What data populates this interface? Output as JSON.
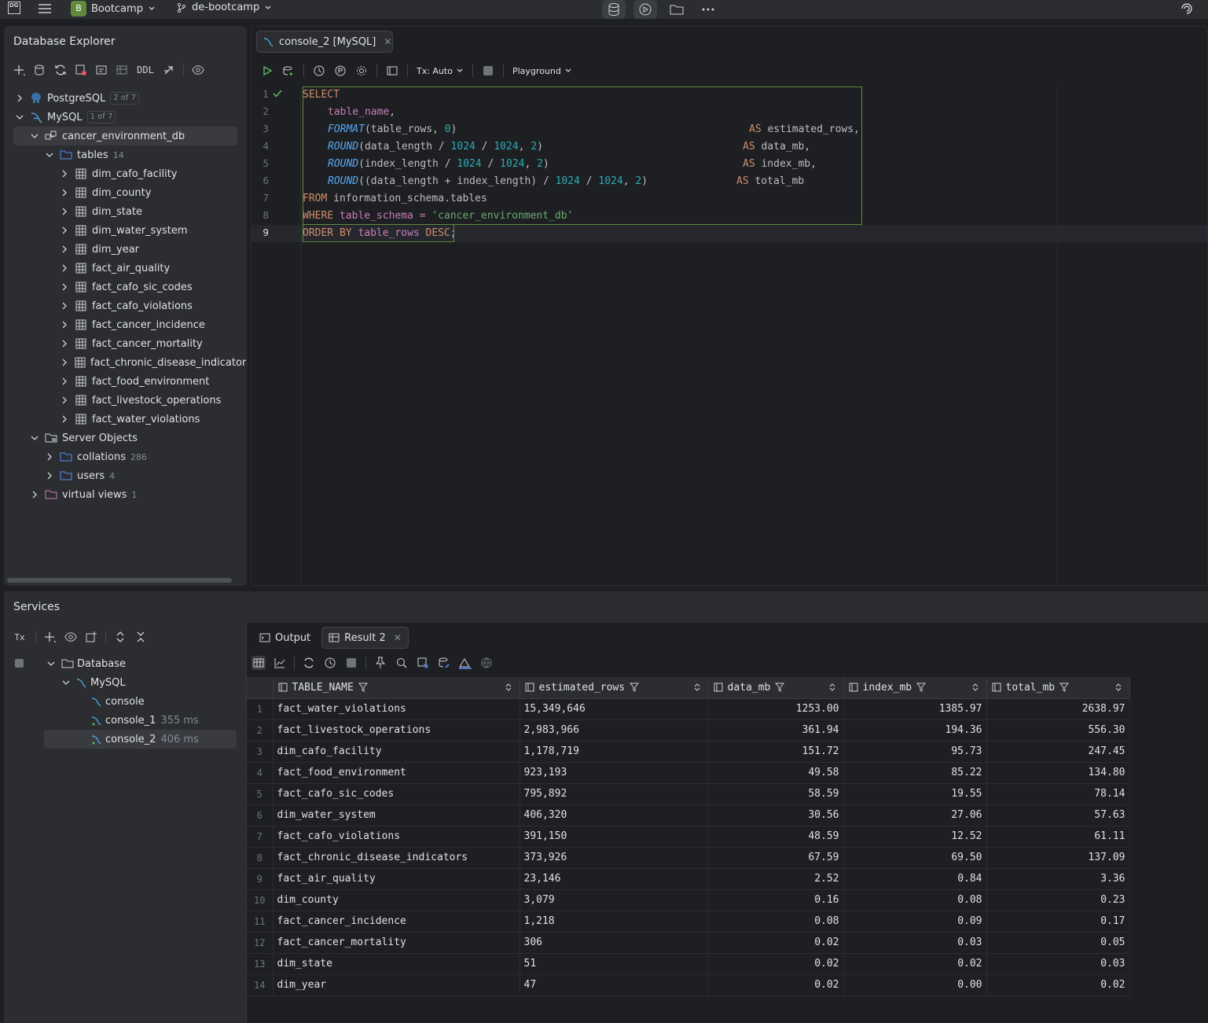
{
  "topbar": {
    "app_logo": "DG",
    "project_badge": "B",
    "project_name": "Bootcamp",
    "branch_name": "de-bootcamp"
  },
  "explorer": {
    "title": "Database Explorer",
    "toolbar_ddl": "DDL",
    "postgres": {
      "label": "PostgreSQL",
      "count": "2 of 7"
    },
    "mysql": {
      "label": "MySQL",
      "count": "1 of 7"
    },
    "schema": "cancer_environment_db",
    "tables_folder": {
      "label": "tables",
      "count": "14"
    },
    "tables": [
      "dim_cafo_facility",
      "dim_county",
      "dim_state",
      "dim_water_system",
      "dim_year",
      "fact_air_quality",
      "fact_cafo_sic_codes",
      "fact_cafo_violations",
      "fact_cancer_incidence",
      "fact_cancer_mortality",
      "fact_chronic_disease_indicators",
      "fact_food_environment",
      "fact_livestock_operations",
      "fact_water_violations"
    ],
    "server_objects": "Server Objects",
    "collations": {
      "label": "collations",
      "count": "286"
    },
    "users": {
      "label": "users",
      "count": "4"
    },
    "virtual_views": {
      "label": "virtual views",
      "count": "1"
    }
  },
  "editor": {
    "tab_label": "console_2 [MySQL]",
    "tx_mode": "Tx: Auto",
    "playground": "Playground",
    "line_numbers": [
      "1",
      "2",
      "3",
      "4",
      "5",
      "6",
      "7",
      "8",
      "9"
    ],
    "code": {
      "l1_kw": "SELECT",
      "l2_col": "table_name",
      "l2_punct": ",",
      "l3_fn": "FORMAT",
      "l3_a": "(table_rows, ",
      "l3_num": "0",
      "l3_b": ")",
      "l3_as": "AS",
      "l3_alias": " estimated_rows,",
      "l4_fn": "ROUND",
      "l4_a": "(data_length / ",
      "l4_n1": "1024",
      "l4_b": " / ",
      "l4_n2": "1024",
      "l4_c": ", ",
      "l4_n3": "2",
      "l4_d": ")",
      "l4_as": "AS",
      "l4_alias": " data_mb,",
      "l5_fn": "ROUND",
      "l5_a": "(index_length / ",
      "l5_n1": "1024",
      "l5_b": " / ",
      "l5_n2": "1024",
      "l5_c": ", ",
      "l5_n3": "2",
      "l5_d": ")",
      "l5_as": "AS",
      "l5_alias": " index_mb,",
      "l6_fn": "ROUND",
      "l6_a": "((data_length + index_length) / ",
      "l6_n1": "1024",
      "l6_b": " / ",
      "l6_n2": "1024",
      "l6_c": ", ",
      "l6_n3": "2",
      "l6_d": ")",
      "l6_as": "AS",
      "l6_alias": " total_mb",
      "l7_kw": "FROM",
      "l7_rest": " information_schema.tables",
      "l8_kw": "WHERE",
      "l8_a": " table_schema = ",
      "l8_str": "'cancer_environment_db'",
      "l9_kw": "ORDER BY",
      "l9_a": " table_rows ",
      "l9_kw2": "DESC",
      "l9_end": ";"
    }
  },
  "services": {
    "title": "Services",
    "tx_label": "Tx",
    "tree": {
      "database": "Database",
      "mysql": "MySQL",
      "consoles": [
        {
          "label": "console",
          "duration": ""
        },
        {
          "label": "console_1",
          "duration": "355 ms"
        },
        {
          "label": "console_2",
          "duration": "406 ms"
        }
      ]
    },
    "tabs": {
      "output": "Output",
      "result": "Result 2"
    },
    "columns": [
      "TABLE_NAME",
      "estimated_rows",
      "data_mb",
      "index_mb",
      "total_mb"
    ],
    "rows": [
      [
        "1",
        "fact_water_violations",
        "15,349,646",
        "1253.00",
        "1385.97",
        "2638.97"
      ],
      [
        "2",
        "fact_livestock_operations",
        "2,983,966",
        "361.94",
        "194.36",
        "556.30"
      ],
      [
        "3",
        "dim_cafo_facility",
        "1,178,719",
        "151.72",
        "95.73",
        "247.45"
      ],
      [
        "4",
        "fact_food_environment",
        "923,193",
        "49.58",
        "85.22",
        "134.80"
      ],
      [
        "5",
        "fact_cafo_sic_codes",
        "795,892",
        "58.59",
        "19.55",
        "78.14"
      ],
      [
        "6",
        "dim_water_system",
        "406,320",
        "30.56",
        "27.06",
        "57.63"
      ],
      [
        "7",
        "fact_cafo_violations",
        "391,150",
        "48.59",
        "12.52",
        "61.11"
      ],
      [
        "8",
        "fact_chronic_disease_indicators",
        "373,926",
        "67.59",
        "69.50",
        "137.09"
      ],
      [
        "9",
        "fact_air_quality",
        "23,146",
        "2.52",
        "0.84",
        "3.36"
      ],
      [
        "10",
        "dim_county",
        "3,079",
        "0.16",
        "0.08",
        "0.23"
      ],
      [
        "11",
        "fact_cancer_incidence",
        "1,218",
        "0.08",
        "0.09",
        "0.17"
      ],
      [
        "12",
        "fact_cancer_mortality",
        "306",
        "0.02",
        "0.03",
        "0.05"
      ],
      [
        "13",
        "dim_state",
        "51",
        "0.02",
        "0.02",
        "0.03"
      ],
      [
        "14",
        "dim_year",
        "47",
        "0.02",
        "0.00",
        "0.02"
      ]
    ]
  }
}
